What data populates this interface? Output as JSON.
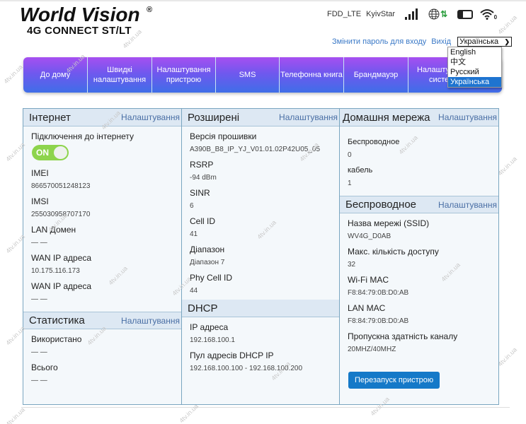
{
  "logo": {
    "brand": "World Vision",
    "registered": "®",
    "model": "4G CONNECT ST/LT"
  },
  "status_bar": {
    "network_type": "FDD_LTE",
    "carrier": "KyivStar",
    "signal_icon": "signal-bars-icon",
    "data_icon": "globe-data-icon",
    "battery_icon": "battery-icon",
    "wifi_icon": "wifi-icon",
    "wifi_clients": "0",
    "data_arrows": "⇅"
  },
  "top_links": {
    "change_password": "Змінити пароль для входу",
    "logout": "Вихід"
  },
  "language": {
    "selected": "Українська",
    "options": [
      "English",
      "中文",
      "Русский",
      "Українська"
    ]
  },
  "nav": [
    {
      "label": "До дому"
    },
    {
      "label": "Швидкі налаштування"
    },
    {
      "label": "Налаштування пристрою"
    },
    {
      "label": "SMS"
    },
    {
      "label": "Телефонна книга"
    },
    {
      "label": "Брандмауэр"
    },
    {
      "label": "Налаштування системи"
    }
  ],
  "settings_label": "Налаштування",
  "internet": {
    "title": "Інтернет",
    "connection_label": "Підключення до інтернету",
    "toggle_state": "ON",
    "rows": [
      {
        "label": "IMEI",
        "value": "866570051248123"
      },
      {
        "label": "IMSI",
        "value": "255030958707170"
      },
      {
        "label": "LAN Домен",
        "value": "— —"
      },
      {
        "label": "WAN IP адреса",
        "value": "10.175.116.173"
      },
      {
        "label": "WAN IP адреса",
        "value": "— —"
      }
    ]
  },
  "statistics": {
    "title": "Статистика",
    "rows": [
      {
        "label": "Використано",
        "value": "— —"
      },
      {
        "label": "Всього",
        "value": "— —"
      }
    ]
  },
  "advanced": {
    "title": "Розширені",
    "rows": [
      {
        "label": "Версія прошивки",
        "value": "A390B_B8_IP_YJ_V01.01.02P42U05_05"
      },
      {
        "label": "RSRP",
        "value": "-94 dBm"
      },
      {
        "label": "SINR",
        "value": "6"
      },
      {
        "label": "Cell ID",
        "value": "41"
      },
      {
        "label": "Діапазон",
        "value": "Діапазон 7"
      },
      {
        "label": "Phy Cell ID",
        "value": "44"
      }
    ]
  },
  "dhcp": {
    "title": "DHCP",
    "rows": [
      {
        "label": "IP адреса",
        "value": "192.168.100.1"
      },
      {
        "label": "Пул адресів DHCP IP",
        "value": "192.168.100.100 - 192.168.100.200"
      }
    ]
  },
  "home_network": {
    "title": "Домашня мережа",
    "rows": [
      {
        "label": "Беспроводное",
        "value": "0"
      },
      {
        "label": "кабель",
        "value": "1"
      }
    ]
  },
  "wireless": {
    "title": "Беспроводное",
    "rows": [
      {
        "label": "Назва мережі (SSID)",
        "value": "WV4G_D0AB"
      },
      {
        "label": "Макс. кількість доступу",
        "value": "32"
      },
      {
        "label": "Wi-Fi MAC",
        "value": "F8:84:79:0B:D0:AB"
      },
      {
        "label": "LAN MAC",
        "value": "F8:84:79:0B:D0:AB"
      },
      {
        "label": "Пропускна здатність каналу",
        "value": "20MHZ/40MHZ"
      }
    ],
    "reboot_button": "Перезапуск пристрою"
  },
  "watermark": "4tv.in.ua",
  "colors": {
    "nav_gradient_top": "#a64ff0",
    "nav_gradient_bottom": "#3f6ee8",
    "toggle_on": "#8dd44c",
    "link": "#3a79c7",
    "button": "#1579c8",
    "panel_header": "#dde8f3",
    "panel_border": "#7aa6c0"
  }
}
